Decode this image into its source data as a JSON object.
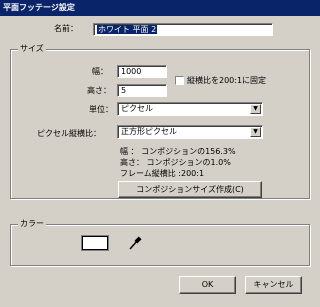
{
  "window": {
    "title": "平面フッテージ設定"
  },
  "name": {
    "label": "名前：",
    "value": "ホワイト 平面 2"
  },
  "size_group": {
    "title": "サイズ",
    "width_label": "幅：",
    "width_value": "1000",
    "height_label": "高さ：",
    "height_value": "5",
    "lock_ratio_label": "縦横比を200:1に固定",
    "lock_ratio_checked": false,
    "units_label": "単位：",
    "units_value": "ピクセル",
    "pixel_aspect_label": "ピクセル縦横比：",
    "pixel_aspect_value": "正方形ピクセル",
    "info_width": "幅 ： コンポジションの156.3%",
    "info_height": "高さ： コンポジションの1.0%",
    "info_aspect": "フレーム縦横比 :200:1",
    "make_comp_size_button": "コンポジションサイズ作成(C)"
  },
  "color_group": {
    "title": "カラー",
    "swatch_color": "#ffffff",
    "eyedropper_icon": "eyedropper-icon"
  },
  "buttons": {
    "ok": "OK",
    "cancel": "キャンセル"
  },
  "colors": {
    "titlebar": "#0a246a",
    "dialog_bg": "#d4d0c8",
    "selection": "#0a246a"
  }
}
